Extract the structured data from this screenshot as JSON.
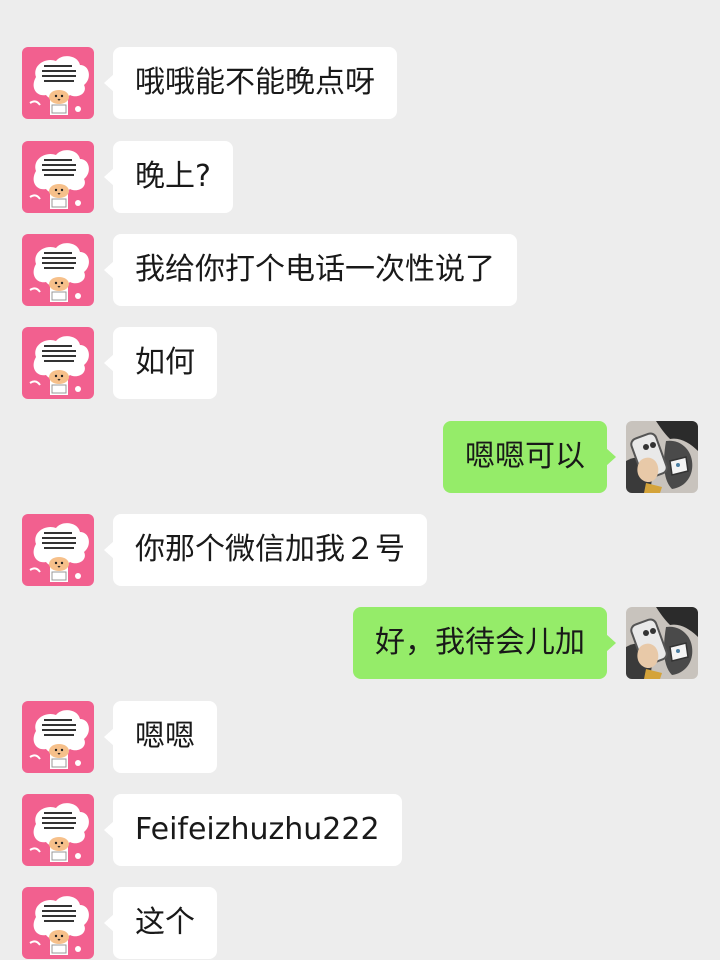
{
  "conversation": {
    "messages": [
      {
        "side": "left",
        "text": "哦哦能不能晚点呀",
        "avatar": "hamster-cloud-avatar-icon"
      },
      {
        "side": "left",
        "text": "晚上?",
        "avatar": "hamster-cloud-avatar-icon"
      },
      {
        "side": "left",
        "text": "我给你打个电话一次性说了",
        "avatar": "hamster-cloud-avatar-icon"
      },
      {
        "side": "left",
        "text": "如何",
        "avatar": "hamster-cloud-avatar-icon"
      },
      {
        "side": "right",
        "text": "嗯嗯可以",
        "avatar": "phone-selfie-avatar-icon"
      },
      {
        "side": "left",
        "text": "你那个微信加我２号",
        "avatar": "hamster-cloud-avatar-icon"
      },
      {
        "side": "right",
        "text": "好，我待会儿加",
        "avatar": "phone-selfie-avatar-icon"
      },
      {
        "side": "left",
        "text": "嗯嗯",
        "avatar": "hamster-cloud-avatar-icon"
      },
      {
        "side": "left",
        "text": "Feifeizhuzhu222",
        "avatar": "hamster-cloud-avatar-icon"
      },
      {
        "side": "left",
        "text": "这个",
        "avatar": "hamster-cloud-avatar-icon"
      }
    ]
  },
  "colors": {
    "background": "#ededed",
    "incoming_bubble": "#ffffff",
    "outgoing_bubble": "#95ec69",
    "text": "#191919",
    "contact_avatar_bg": "#f2608f"
  }
}
